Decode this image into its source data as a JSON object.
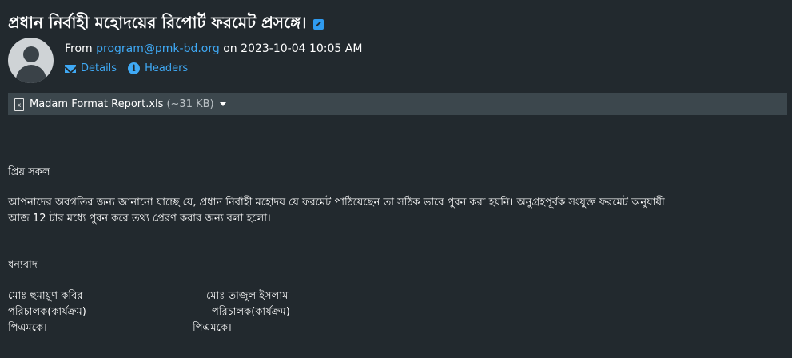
{
  "message": {
    "subject": "প্রধান নির্বাহী মহোদয়ের রিপোর্ট ফরমেট প্রসঙ্গে।",
    "from_label": "From",
    "from_email": "program@pmk-bd.org",
    "on_label": "on",
    "date": "2023-10-04 10:05 AM",
    "actions": {
      "details": "Details",
      "headers": "Headers"
    }
  },
  "attachment": {
    "name": "Madam Format Report.xls",
    "size": "(~31 KB)"
  },
  "body": {
    "greeting": "প্রিয় সকল",
    "para_line1": "আপনাদের অবগতির জন্য জানানো  যাচ্ছে যে, প্রধান নির্বাহী মহোদয় যে ফরমেট পাঠিয়েছেন তা সঠিক ভাবে পুরন করা হয়নি। অনুগ্রহপূর্বক সংযুক্ত ফরমেট অনুযায়ী",
    "para_line2": "আজ 12 টার  মধ্যে পুরন করে তথ্য প্রেরণ করার জন্য বলা হলো।",
    "thanks": "ধন্যবাদ",
    "signatures": [
      {
        "name": "মোঃ হুমায়ুণ কবির",
        "title": "পরিচালক(কার্যক্রম)",
        "org": "পিএমকে।"
      },
      {
        "name": "মোঃ তাজুল ইসলাম",
        "title": "পরিচালক(কার্যক্রম)",
        "org": "পিএমকে।"
      }
    ]
  }
}
